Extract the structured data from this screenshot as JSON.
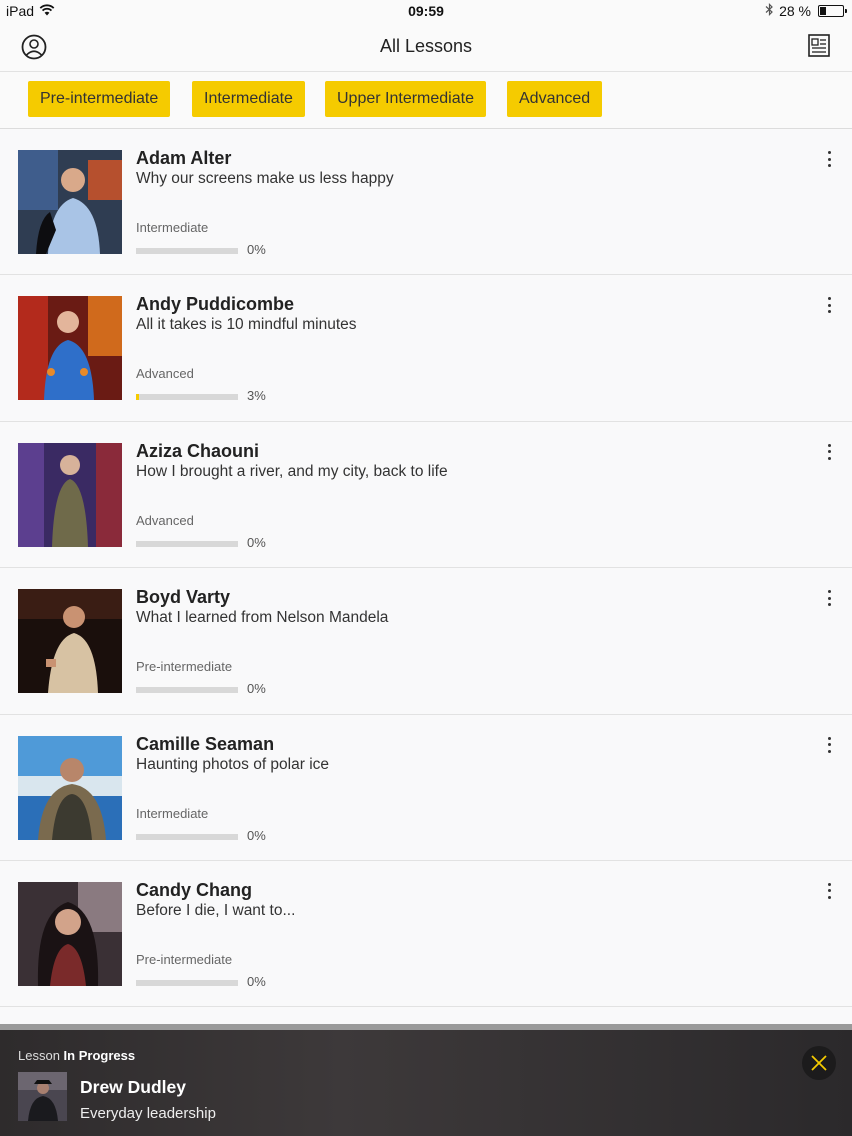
{
  "status_bar": {
    "device": "iPad",
    "time": "09:59",
    "battery_percent": "28 %",
    "battery_level": 0.28
  },
  "header": {
    "title": "All Lessons",
    "profile_icon": "user-circle-icon",
    "notes_icon": "notebook-icon"
  },
  "filters": [
    {
      "label": "Pre-intermediate"
    },
    {
      "label": "Intermediate"
    },
    {
      "label": "Upper Intermediate"
    },
    {
      "label": "Advanced"
    }
  ],
  "lessons": [
    {
      "speaker": "Adam Alter",
      "talk": "Why our screens make us less happy",
      "level": "Intermediate",
      "progress_text": "0%",
      "progress": 0
    },
    {
      "speaker": "Andy Puddicombe",
      "talk": "All it takes is 10 mindful minutes",
      "level": "Advanced",
      "progress_text": "3%",
      "progress": 0.03
    },
    {
      "speaker": "Aziza Chaouni",
      "talk": "How I brought a river, and my city, back to life",
      "level": "Advanced",
      "progress_text": "0%",
      "progress": 0
    },
    {
      "speaker": "Boyd Varty",
      "talk": "What I learned from Nelson Mandela",
      "level": "Pre-intermediate",
      "progress_text": "0%",
      "progress": 0
    },
    {
      "speaker": "Camille Seaman",
      "talk": "Haunting photos of polar ice",
      "level": "Intermediate",
      "progress_text": "0%",
      "progress": 0
    },
    {
      "speaker": "Candy Chang",
      "talk": "Before I die, I want to...",
      "level": "Pre-intermediate",
      "progress_text": "0%",
      "progress": 0
    }
  ],
  "in_progress": {
    "label_prefix": "Lesson",
    "label_bold": "In Progress",
    "speaker": "Drew Dudley",
    "talk": "Everyday leadership",
    "close_icon": "close-icon"
  },
  "colors": {
    "accent": "#f5cb00",
    "banner_bg": "#2e2b2c"
  }
}
